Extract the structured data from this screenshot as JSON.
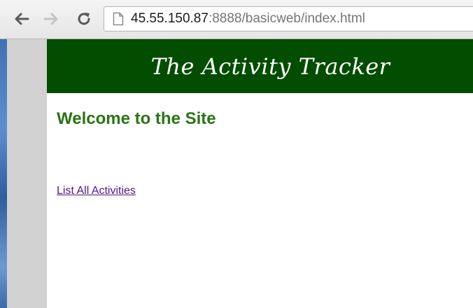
{
  "browser": {
    "url_host": "45.55.150.87",
    "url_rest": ":8888/basicweb/index.html",
    "icons": {
      "back": "arrow-left-icon",
      "forward": "arrow-right-icon",
      "reload": "reload-icon",
      "page": "page-icon"
    }
  },
  "site": {
    "title": "The Activity Tracker",
    "welcome_heading": "Welcome to the Site",
    "links": {
      "list_all": "List All Activities"
    }
  },
  "colors": {
    "header_bg": "#024d00",
    "heading_green": "#2a7514",
    "visited_link": "#4b1a8a"
  }
}
